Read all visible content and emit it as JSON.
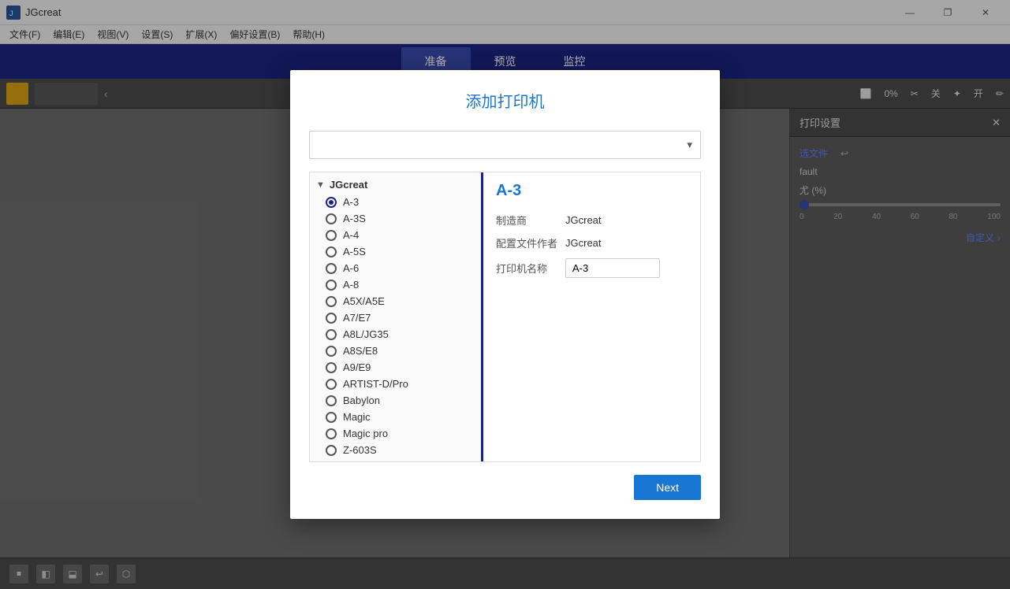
{
  "app": {
    "title": "JGcreat"
  },
  "titlebar": {
    "title": "JGcreat",
    "minimize": "—",
    "restore": "❐",
    "close": "✕"
  },
  "menubar": {
    "items": [
      "文件(F)",
      "编辑(E)",
      "视图(V)",
      "设置(S)",
      "扩展(X)",
      "偏好设置(B)",
      "帮助(H)"
    ]
  },
  "topnav": {
    "items": [
      "准备",
      "预览",
      "监控"
    ],
    "active": "准备"
  },
  "toolbar": {
    "chevron": "‹",
    "right_items": {
      "progress_label": "0%",
      "off_label": "关",
      "on_label": "开"
    }
  },
  "right_panel": {
    "title": "打印设置",
    "close": "✕",
    "file_label": "选文件",
    "undo_label": "↩",
    "profile_value": "fault",
    "percent_label": "尤 (%)",
    "slider_value": 0,
    "slider_marks": [
      "0",
      "20",
      "40",
      "60",
      "80",
      "100"
    ],
    "customize_label": "自定义",
    "customize_arrow": "›"
  },
  "dialog": {
    "title": "添加打印机",
    "dropdown_placeholder": "",
    "group_name": "JGcreat",
    "printers": [
      {
        "name": "A-3",
        "selected": true
      },
      {
        "name": "A-3S",
        "selected": false
      },
      {
        "name": "A-4",
        "selected": false
      },
      {
        "name": "A-5S",
        "selected": false
      },
      {
        "name": "A-6",
        "selected": false
      },
      {
        "name": "A-8",
        "selected": false
      },
      {
        "name": "A5X/A5E",
        "selected": false
      },
      {
        "name": "A7/E7",
        "selected": false
      },
      {
        "name": "A8L/JG35",
        "selected": false
      },
      {
        "name": "A8S/E8",
        "selected": false
      },
      {
        "name": "A9/E9",
        "selected": false
      },
      {
        "name": "ARTIST-D/Pro",
        "selected": false
      },
      {
        "name": "Babylon",
        "selected": false
      },
      {
        "name": "Magic",
        "selected": false
      },
      {
        "name": "Magic pro",
        "selected": false
      },
      {
        "name": "Z-603S",
        "selected": false
      }
    ],
    "detail": {
      "selected_name": "A-3",
      "manufacturer_label": "制造商",
      "manufacturer_value": "JGcreat",
      "profile_label": "配置文件作者",
      "profile_value": "JGcreat",
      "printer_name_label": "打印机名称",
      "printer_name_value": "A-3"
    },
    "next_button": "Next"
  },
  "bottom_icons": [
    "⏹",
    "⏹",
    "⏹",
    "⏹",
    "⏹"
  ]
}
